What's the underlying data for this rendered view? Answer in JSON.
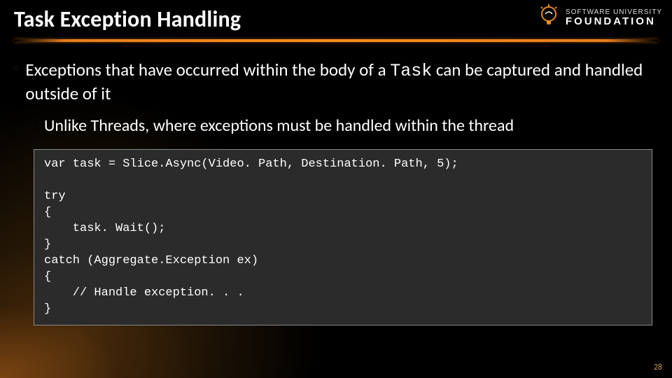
{
  "title": "Task Exception Handling",
  "logo": {
    "line1": "SOFTWARE UNIVERSITY",
    "line2": "FOUNDATION"
  },
  "bullets": {
    "l1_pre": "Exceptions that have occurred within the body of a ",
    "l1_code": "Task",
    "l1_post": " can be captured and handled outside of it",
    "l2": "Unlike Threads, where exceptions must be handled within the thread"
  },
  "code": "var task = Slice.Async(Video. Path, Destination. Path, 5);\n\ntry\n{\n    task. Wait();\n}\ncatch (Aggregate.Exception ex)\n{\n    // Handle exception. . .\n}",
  "page_number": "28"
}
